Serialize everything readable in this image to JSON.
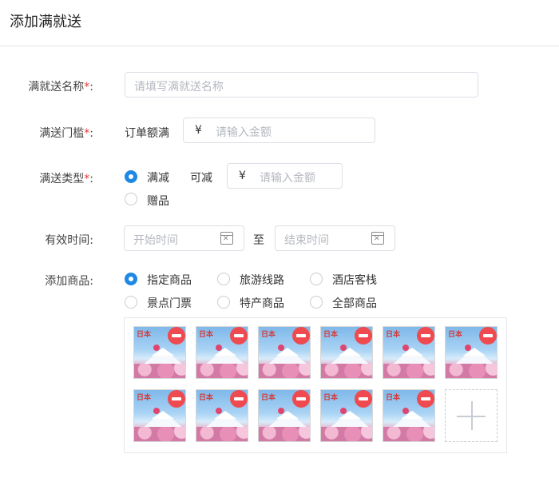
{
  "header": {
    "title": "添加满就送"
  },
  "form": {
    "name": {
      "label": "满就送名称",
      "required": "*",
      "colon": ":",
      "placeholder": "请填写满就送名称"
    },
    "threshold": {
      "label": "满送门槛",
      "required": "*",
      "colon": ":",
      "prefix_text": "订单额满",
      "currency": "¥",
      "placeholder": "请输入金额"
    },
    "type": {
      "label": "满送类型",
      "required": "*",
      "colon": ":",
      "options": [
        {
          "label": "满减",
          "selected": true
        },
        {
          "label": "赠品",
          "selected": false
        }
      ],
      "discount_text": "可减",
      "currency": "¥",
      "placeholder": "请输入金额"
    },
    "validity": {
      "label": "有效时间:",
      "start_placeholder": "开始时间",
      "separator": "至",
      "end_placeholder": "结束时间"
    },
    "goods": {
      "label": "添加商品:",
      "options": [
        {
          "label": "指定商品",
          "selected": true
        },
        {
          "label": "旅游线路",
          "selected": false
        },
        {
          "label": "酒店客栈",
          "selected": false
        },
        {
          "label": "景点门票",
          "selected": false
        },
        {
          "label": "特产商品",
          "selected": false
        },
        {
          "label": "全部商品",
          "selected": false
        }
      ],
      "image_count": 11,
      "thumb_text": "日本"
    }
  },
  "colors": {
    "accent": "#1e88e5",
    "required": "#e53935",
    "delete": "#ee4a4f"
  },
  "icons": [
    "calendar-icon",
    "remove-icon",
    "plus-icon"
  ]
}
